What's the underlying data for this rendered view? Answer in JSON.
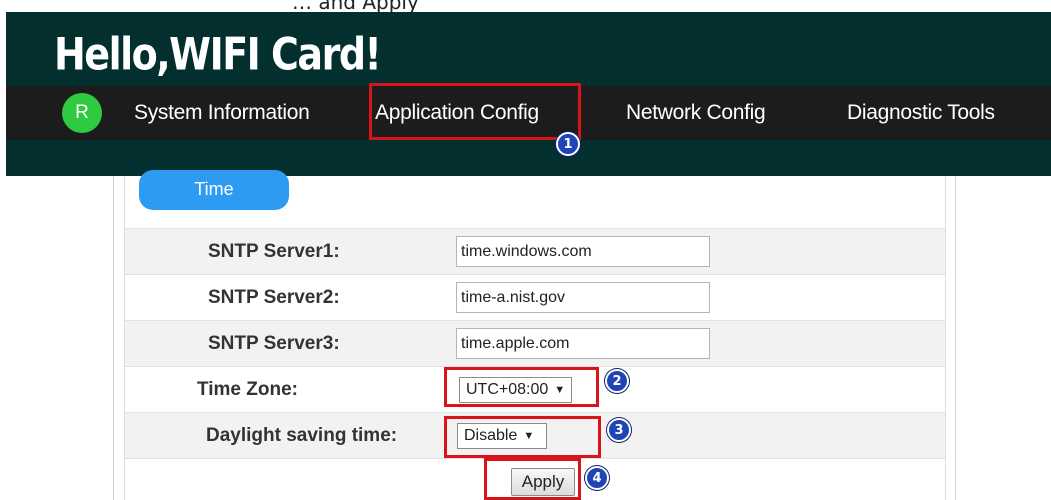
{
  "top_caption": "… and Apply",
  "header": {
    "brand": "Hello,WIFI Card!",
    "avatar_letter": "R",
    "nav": [
      {
        "label": "System Information"
      },
      {
        "label": "Application Config"
      },
      {
        "label": "Network Config"
      },
      {
        "label": "Diagnostic Tools"
      }
    ]
  },
  "section": {
    "title": "Time"
  },
  "form": {
    "sntp1": {
      "label": "SNTP Server1:",
      "value": "time.windows.com"
    },
    "sntp2": {
      "label": "SNTP Server2:",
      "value": "time-a.nist.gov"
    },
    "sntp3": {
      "label": "SNTP Server3:",
      "value": "time.apple.com"
    },
    "timezone": {
      "label": "Time Zone:",
      "value": "UTC+08:00"
    },
    "dst": {
      "label": "Daylight saving time:",
      "value": "Disable"
    },
    "apply_label": "Apply"
  },
  "annotations": {
    "step1": "1",
    "step2": "2",
    "step3": "3",
    "step4": "4"
  },
  "colors": {
    "header_bg": "#03302e",
    "navbar_bg": "#1c1c1c",
    "avatar": "#2ecb41",
    "pill": "#2d9bf2",
    "highlight": "#d8141b",
    "badge": "#1f44b8"
  },
  "icons": {
    "dropdown": "triangle-down-icon"
  }
}
